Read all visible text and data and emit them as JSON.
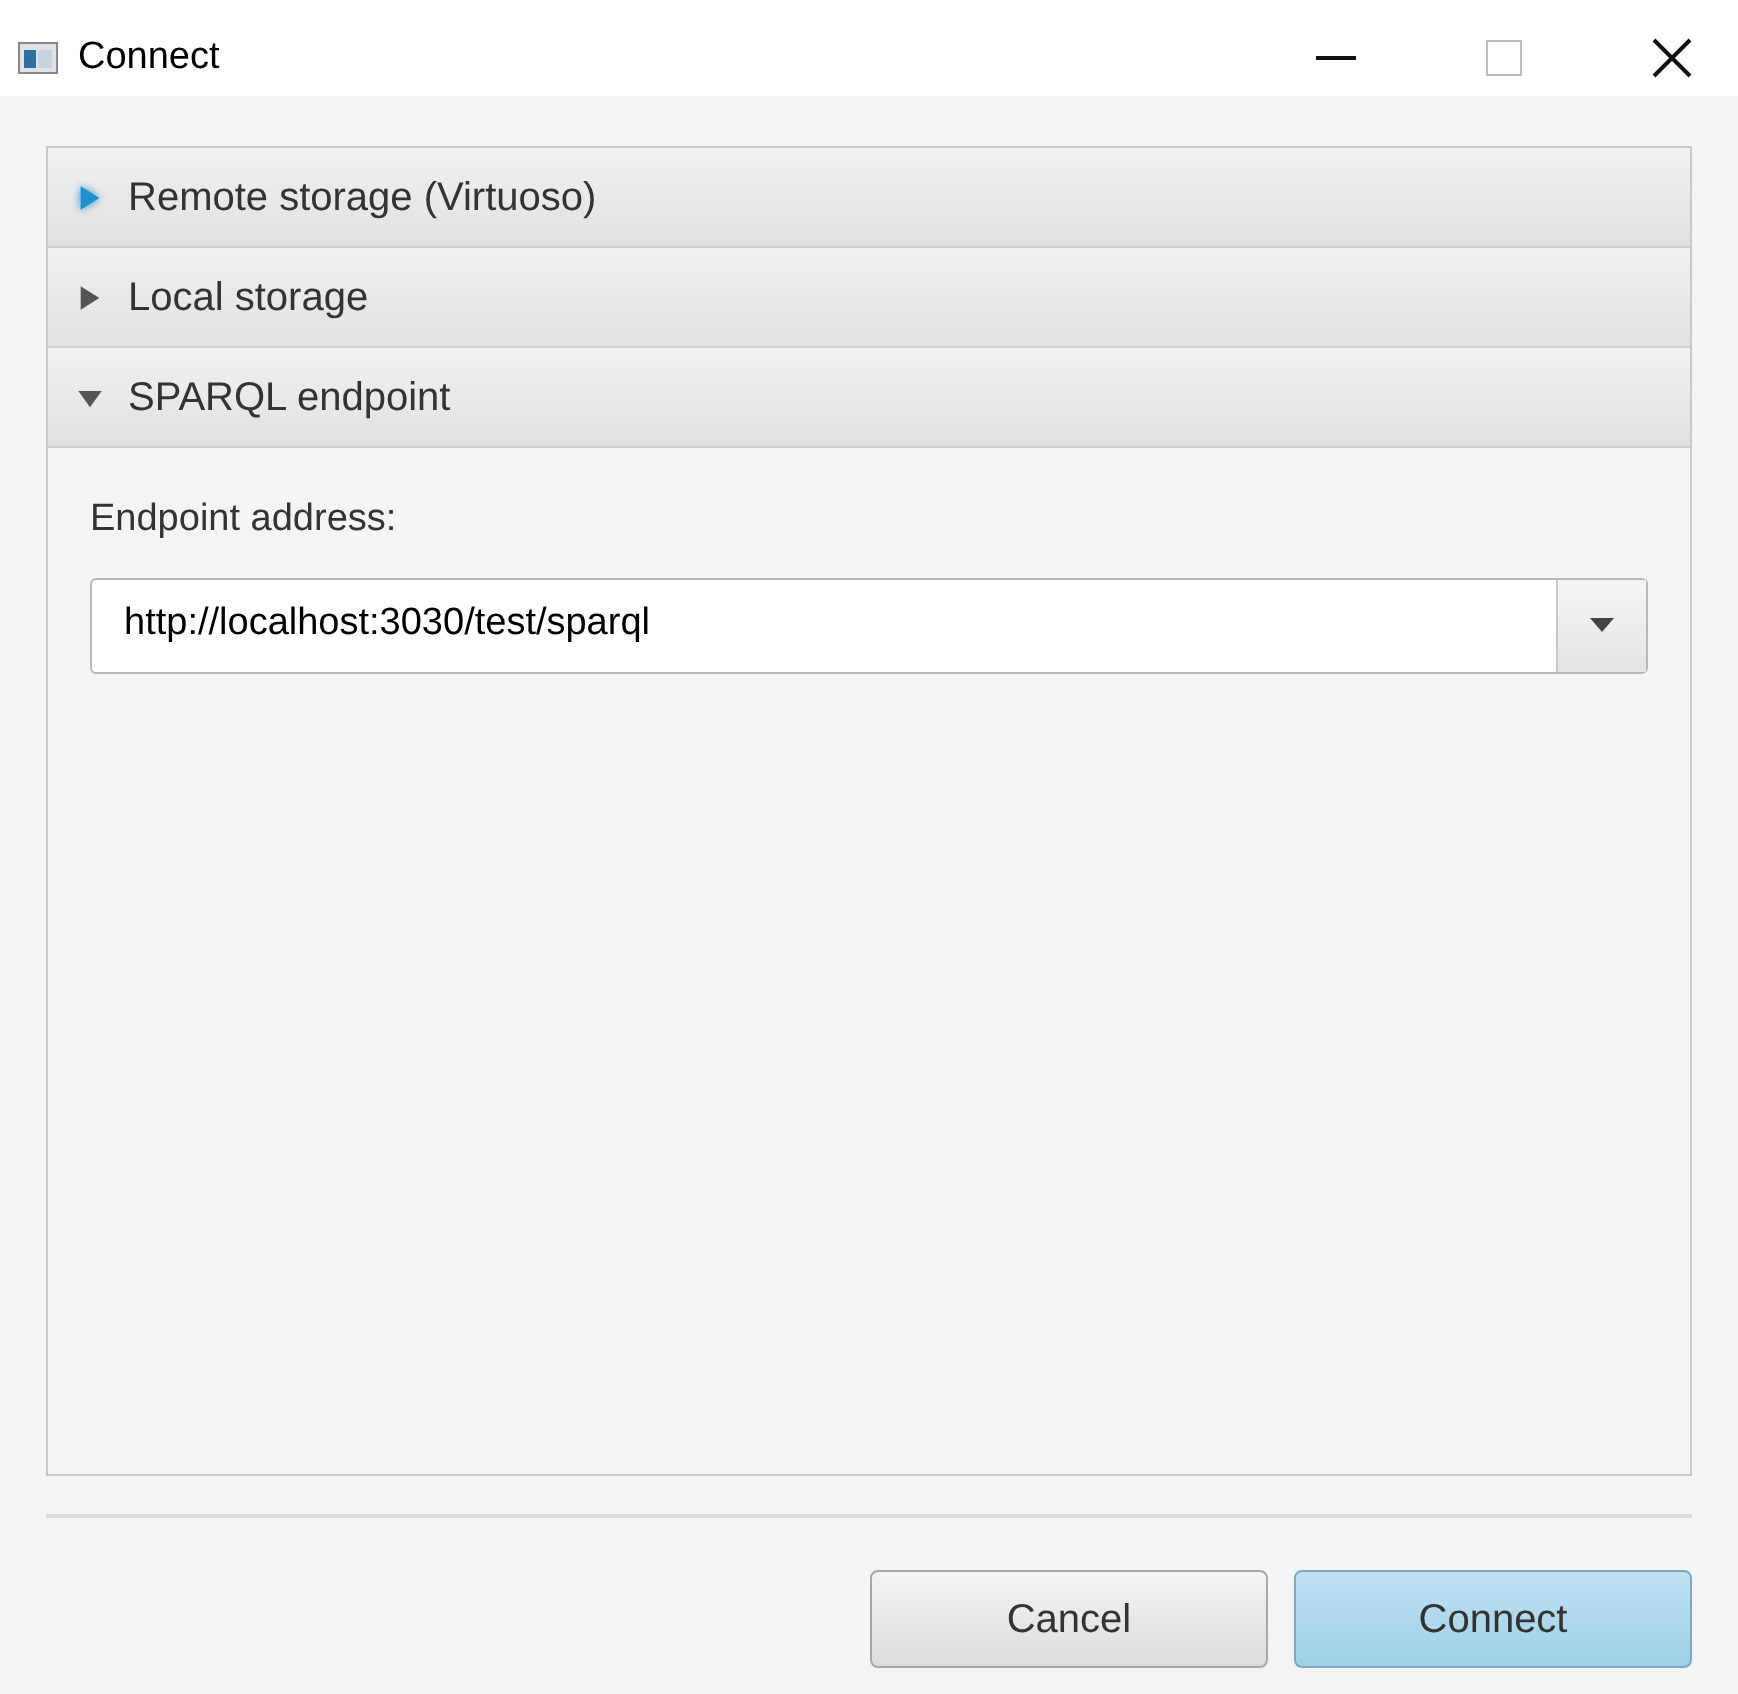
{
  "window": {
    "title": "Connect"
  },
  "panes": [
    {
      "title": "Remote storage (Virtuoso)",
      "expanded": false,
      "focused": true
    },
    {
      "title": "Local storage",
      "expanded": false,
      "focused": false
    },
    {
      "title": "SPARQL endpoint",
      "expanded": true,
      "focused": false,
      "field_label": "Endpoint address:",
      "value": "http://localhost:3030/test/sparql"
    }
  ],
  "buttons": [
    {
      "label": "Cancel",
      "default": false
    },
    {
      "label": "Connect",
      "default": true
    }
  ]
}
